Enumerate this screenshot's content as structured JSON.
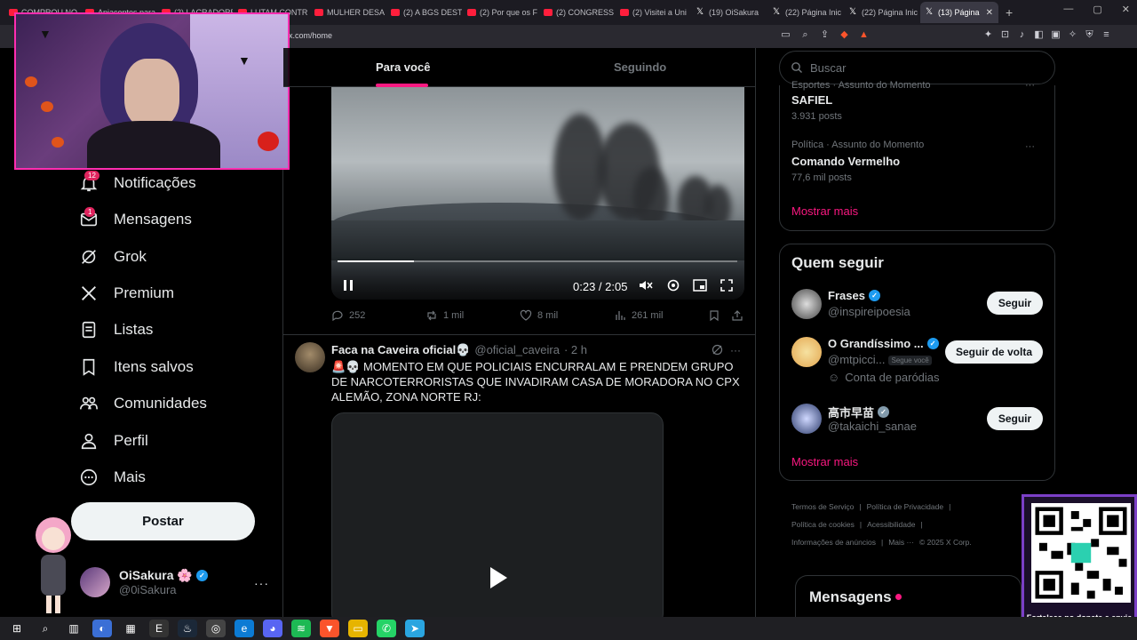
{
  "browser": {
    "tabs": [
      {
        "label": "COMPROU NO",
        "type": "yt"
      },
      {
        "label": "Apiacentes para",
        "type": "yt"
      },
      {
        "label": "(2) LACRADORE",
        "type": "yt"
      },
      {
        "label": "LUTAM CONTR",
        "type": "yt"
      },
      {
        "label": "MULHER DESA",
        "type": "yt"
      },
      {
        "label": "(2) A BGS DEST",
        "type": "yt"
      },
      {
        "label": "(2) Por que os F",
        "type": "yt"
      },
      {
        "label": "(2) CONGRESS",
        "type": "yt"
      },
      {
        "label": "(2) Visitei a Uni",
        "type": "yt"
      },
      {
        "label": "(19) OiSakura",
        "type": "x"
      },
      {
        "label": "(22) Página Inic",
        "type": "x"
      },
      {
        "label": "(22) Página Inic",
        "type": "x"
      },
      {
        "label": "(13) Página",
        "type": "x",
        "active": true
      }
    ],
    "url": "x.com/home",
    "new_tab": "+"
  },
  "sidebar": {
    "items": [
      {
        "label": "Notificações",
        "icon": "bell-icon",
        "badge": "12"
      },
      {
        "label": "Mensagens",
        "icon": "mail-icon",
        "badge": "1"
      },
      {
        "label": "Grok",
        "icon": "grok-icon"
      },
      {
        "label": "Premium",
        "icon": "x-logo-icon"
      },
      {
        "label": "Listas",
        "icon": "list-icon"
      },
      {
        "label": "Itens salvos",
        "icon": "bookmark-icon"
      },
      {
        "label": "Comunidades",
        "icon": "communities-icon"
      },
      {
        "label": "Perfil",
        "icon": "person-icon"
      },
      {
        "label": "Mais",
        "icon": "more-circle-icon"
      }
    ],
    "post_button": "Postar",
    "account": {
      "name": "OiSakura 🌸",
      "handle": "@0iSakura",
      "more": "···"
    }
  },
  "feed": {
    "tabs": {
      "for_you": "Para você",
      "following": "Seguindo"
    },
    "video1": {
      "time": "0:23 / 2:05",
      "progress": 0.19
    },
    "actions": {
      "replies": "252",
      "reposts": "1 mil",
      "likes": "8 mil",
      "views": "261 mil"
    },
    "tweet2": {
      "name": "Faca na Caveira oficial💀",
      "handle": "@oficial_caveira",
      "time": "· 2 h",
      "more": "···",
      "text": "🚨💀 MOMENTO EM QUE POLICIAIS ENCURRALAM E PRENDEM GRUPO DE NARCOTERRORISTAS QUE INVADIRAM CASA DE MORADORA NO CPX ALEMÃO, ZONA NORTE RJ:"
    }
  },
  "right": {
    "search_placeholder": "Buscar",
    "trends": [
      {
        "meta": "Esportes · Assunto do Momento",
        "title": "SAFIEL",
        "count": "3.931 posts"
      },
      {
        "meta": "Política · Assunto do Momento",
        "title": "Comando Vermelho",
        "count": "77,6 mil posts"
      }
    ],
    "trends_more": "···",
    "show_more": "Mostrar mais",
    "who_to_follow": {
      "title": "Quem seguir",
      "accounts": [
        {
          "name": "Frases",
          "handle": "@inspireipoesia",
          "button": "Seguir"
        },
        {
          "name": "O Grandíssimo ...",
          "handle": "@mtpicci...",
          "follows_you": "Segue você",
          "parody": "Conta de paródias",
          "button": "Seguir de volta"
        },
        {
          "name": "高市早苗",
          "handle": "@takaichi_sanae",
          "button": "Seguir"
        }
      ],
      "show_more": "Mostrar mais"
    },
    "footer": [
      "Termos de Serviço",
      "|",
      "Política de Privacidade",
      "|",
      "Política de cookies",
      "|",
      "Acessibilidade",
      "|",
      "Informações de anúncios",
      "|",
      "Mais ···",
      "© 2025 X Corp."
    ],
    "messages_dock": "Mensagens"
  },
  "overlay": {
    "qr_text": "Fortaleça no donate e envie sua mensagem!"
  },
  "colors": {
    "accent": "#f91880",
    "verified": "#1d9bf0"
  }
}
